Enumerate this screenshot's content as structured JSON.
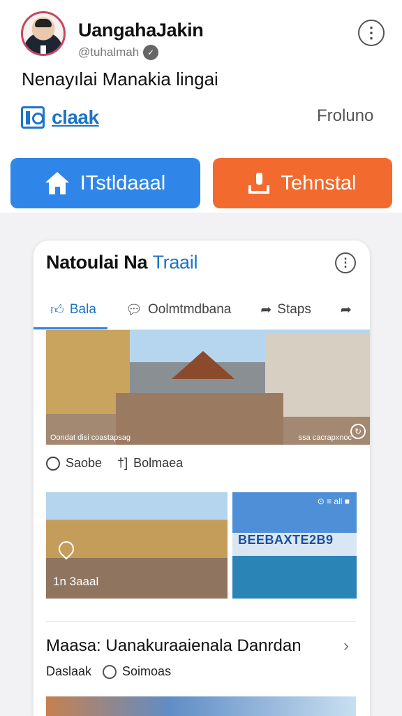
{
  "profile": {
    "name": "UangahaJakin",
    "handle": "@tuhalmah",
    "headline": "Nenayılai Manakia lingai"
  },
  "brand": {
    "label": "claak"
  },
  "header": {
    "follow_label": "Froluno"
  },
  "buttons": {
    "home_label": "ITstldaaal",
    "install_label": "Tehnstal"
  },
  "card": {
    "title_main": "Natoulai Na",
    "title_accent": "Traail",
    "tabs": [
      {
        "label": "Bala",
        "icon": "thumbs-up-icon",
        "active": true
      },
      {
        "label": "Oolmtmdbana",
        "icon": "comment-icon",
        "active": false
      },
      {
        "label": "Staps",
        "icon": "share-icon",
        "active": false
      },
      {
        "label": "",
        "icon": "more-share-icon",
        "active": false
      }
    ],
    "main_photo": {
      "caption_left": "Oondat disi coastapsag",
      "caption_right": "ssa cacrapxnoc"
    },
    "actions": [
      {
        "label": "Saobe",
        "icon": "circle-icon"
      },
      {
        "label": "Bolmaea",
        "icon": "bookmark-icon"
      }
    ],
    "photo_a_overlay": "1n 3aaal",
    "photo_b_status": "⊙ ≡ all ■",
    "photo_b_sign": "BEEBAXTE2B9",
    "post": {
      "title": "Maasa: Uanakuraaienala Danrdan",
      "meta_left": "Daslaak",
      "meta_right": "Soimoas"
    }
  },
  "colors": {
    "accent_blue": "#2f86e8",
    "accent_orange": "#f26a2e",
    "link_blue": "#1d74c8"
  }
}
